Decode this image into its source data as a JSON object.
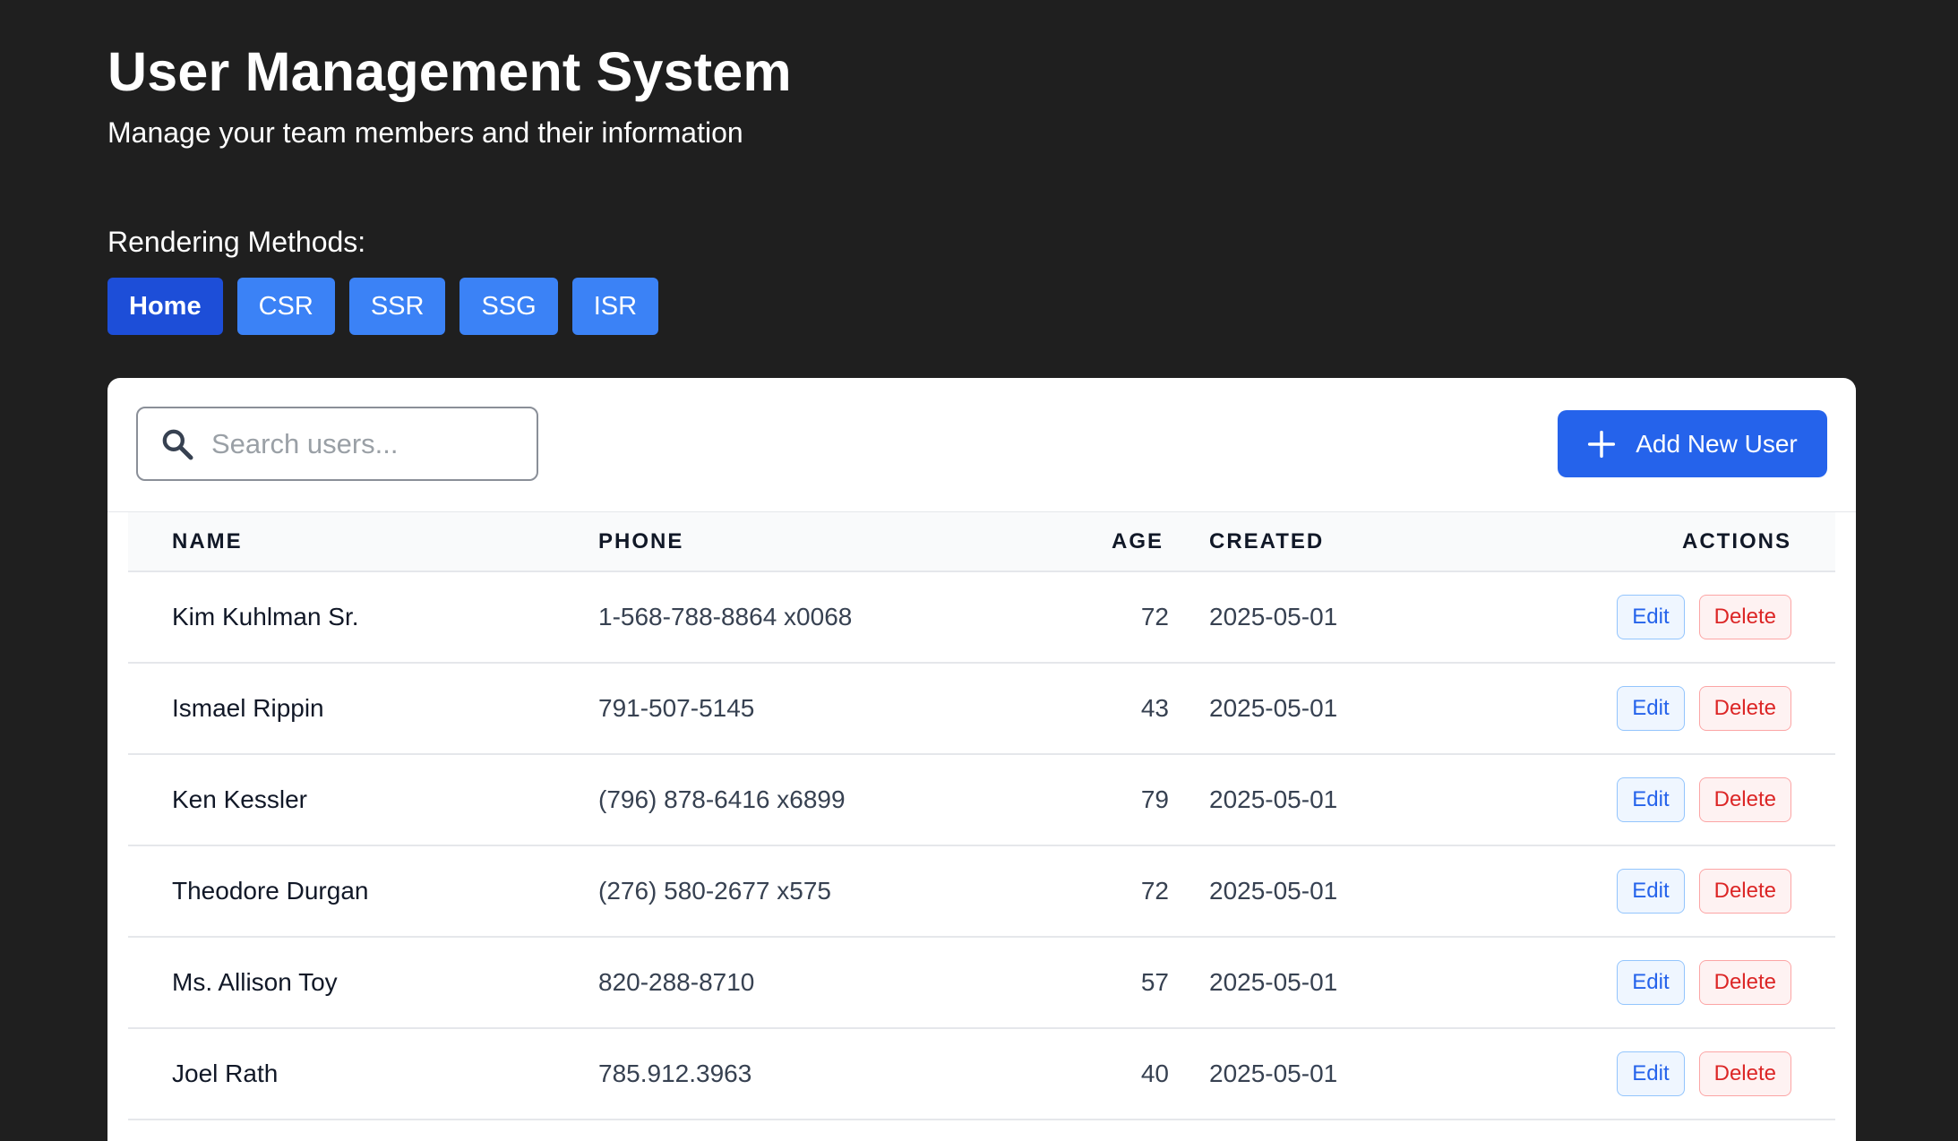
{
  "header": {
    "title": "User Management System",
    "subtitle": "Manage your team members and their information"
  },
  "rendering": {
    "label": "Rendering Methods:",
    "buttons": [
      "Home",
      "CSR",
      "SSR",
      "SSG",
      "ISR"
    ],
    "active": "Home"
  },
  "search": {
    "placeholder": "Search users...",
    "value": ""
  },
  "add_button": {
    "label": "Add New User",
    "icon": "plus-icon"
  },
  "table": {
    "columns": [
      "NAME",
      "PHONE",
      "AGE",
      "CREATED",
      "ACTIONS"
    ],
    "rows": [
      {
        "name": "Kim Kuhlman Sr.",
        "phone": "1-568-788-8864 x0068",
        "age": "72",
        "created": "2025-05-01"
      },
      {
        "name": "Ismael Rippin",
        "phone": "791-507-5145",
        "age": "43",
        "created": "2025-05-01"
      },
      {
        "name": "Ken Kessler",
        "phone": "(796) 878-6416 x6899",
        "age": "79",
        "created": "2025-05-01"
      },
      {
        "name": "Theodore Durgan",
        "phone": "(276) 580-2677 x575",
        "age": "72",
        "created": "2025-05-01"
      },
      {
        "name": "Ms. Allison Toy",
        "phone": "820-288-8710",
        "age": "57",
        "created": "2025-05-01"
      },
      {
        "name": "Joel Rath",
        "phone": "785.912.3963",
        "age": "40",
        "created": "2025-05-01"
      }
    ],
    "edit_label": "Edit",
    "delete_label": "Delete"
  },
  "colors": {
    "background": "#1f1f1f",
    "primary": "#2563eb",
    "active_tab": "#1d4ed8",
    "tab": "#3b82f6",
    "delete": "#dc2626"
  }
}
